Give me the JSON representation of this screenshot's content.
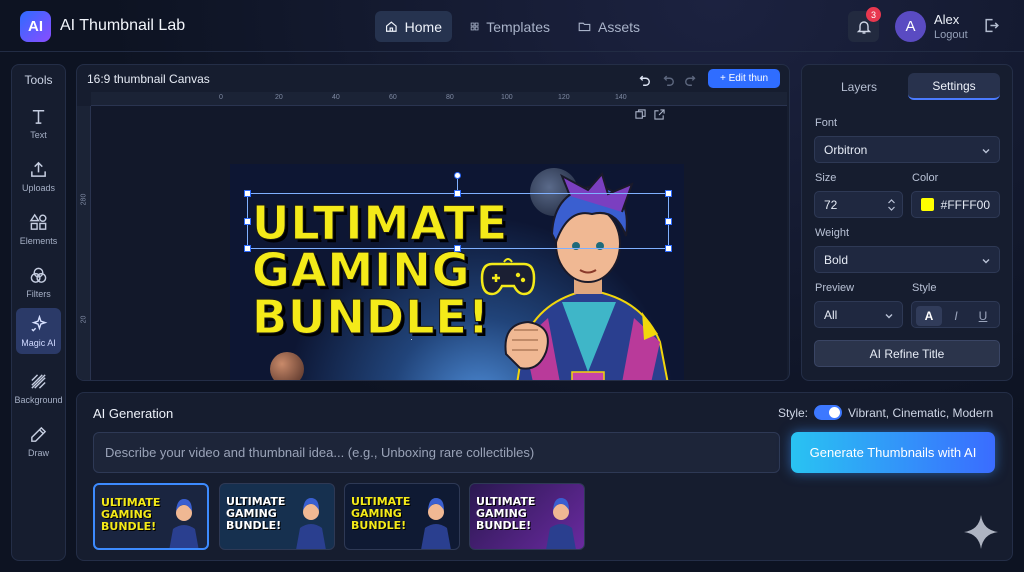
{
  "app": {
    "logo_text": "AI",
    "title": "AI Thumbnail Lab"
  },
  "nav": {
    "tabs": [
      {
        "label": "Home",
        "icon": "home-icon"
      },
      {
        "label": "Templates",
        "icon": "grid-icon"
      },
      {
        "label": "Assets",
        "icon": "folder-icon"
      }
    ]
  },
  "notifications": {
    "count": "3"
  },
  "user": {
    "initial": "A",
    "name": "Alex",
    "logout_label": "Logout"
  },
  "tools": {
    "title": "Tools",
    "items": [
      {
        "label": "Text",
        "icon": "text-icon"
      },
      {
        "label": "Uploads",
        "icon": "upload-icon"
      },
      {
        "label": "Elements",
        "icon": "shapes-icon"
      },
      {
        "label": "Filters",
        "icon": "filters-icon"
      },
      {
        "label": "Magic AI",
        "icon": "sparkle-icon",
        "active": true
      },
      {
        "label": "Background",
        "icon": "background-icon"
      },
      {
        "label": "Draw",
        "icon": "pencil-icon"
      }
    ]
  },
  "canvas": {
    "title": "16:9 thumbnail Canvas",
    "edit_button": "+ Edit thun",
    "ruler_h": [
      "0",
      "20",
      "40",
      "60",
      "80",
      "100",
      "120",
      "140"
    ],
    "ruler_v": [
      "280",
      "20"
    ],
    "headline": [
      "ULTIMATE",
      "GAMING",
      "BUNDLE!"
    ],
    "headline_color": "#F4EA19"
  },
  "panel": {
    "tabs": [
      "Layers",
      "Settings"
    ],
    "active_tab": "Settings",
    "font": {
      "label": "Font",
      "value": "Orbitron"
    },
    "size": {
      "label": "Size",
      "value": "72"
    },
    "color": {
      "label": "Color",
      "value": "#FFFF00"
    },
    "weight": {
      "label": "Weight",
      "value": "Bold"
    },
    "preview": {
      "label": "Preview",
      "value": "All"
    },
    "style": {
      "label": "Style",
      "buttons": [
        "A",
        "I",
        "U"
      ]
    },
    "refine_button": "AI Refine Title"
  },
  "generation": {
    "title": "AI Generation",
    "style_label": "Style:",
    "style_enabled": true,
    "style_value": "Vibrant, Cinematic, Modern",
    "prompt_placeholder": "Describe your video and thumbnail idea... (e.g., Unboxing rare collectibles)",
    "generate_button": "Generate Thumbnails with AI",
    "variants": [
      {
        "lines": [
          "ULTIMATE",
          "GAMING",
          "BUNDLE!"
        ],
        "text_color": "#F4EA19",
        "bg": "#1a2540"
      },
      {
        "lines": [
          "ULTIMATE",
          "GAMING",
          "BUNDLE!"
        ],
        "text_color": "#FFFFFF",
        "bg": "#16304f"
      },
      {
        "lines": [
          "ULTIMATE",
          "GAMING",
          "BUNDLE!"
        ],
        "text_color": "#F4EA19",
        "bg": "#0f1a33"
      },
      {
        "lines": [
          "ULTIMATE",
          "GAMING",
          "BUNDLE!"
        ],
        "text_color": "#FFFFFF",
        "bg": "#4a2470"
      }
    ]
  }
}
